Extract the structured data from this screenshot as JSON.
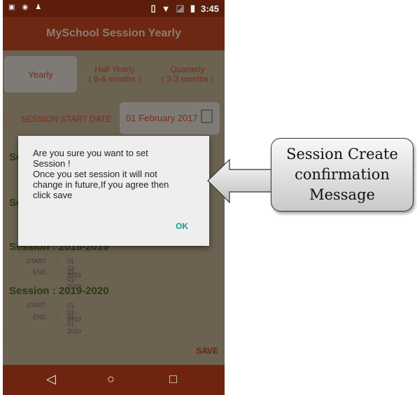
{
  "status_bar": {
    "time": "3:45",
    "icons": [
      "image-icon",
      "news-icon",
      "android-icon",
      "vibrate-icon",
      "wifi-icon",
      "no-sim-icon",
      "battery-charging-icon"
    ]
  },
  "app_bar": {
    "title": "MySchool Session Yearly"
  },
  "tabs": [
    {
      "label": "Yearly",
      "sub": ""
    },
    {
      "label": "Half Yearly",
      "sub": "( 6-6 months )"
    },
    {
      "label": "Quarterly",
      "sub": "( 3-3 months )"
    }
  ],
  "start_date": {
    "label": "SESSION START DATE  :",
    "value": "01 February 2017"
  },
  "sessions_obscured": [
    "Se",
    "Se"
  ],
  "sessions": [
    {
      "title": "Session : 2018-2019",
      "start_label": "START",
      "start": "01-02-2018",
      "end_label": "END",
      "end": "31-01-2019"
    },
    {
      "title": "Session : 2019-2020",
      "start_label": "START",
      "start": "01-02-2019",
      "end_label": "END",
      "end": "31-01-2020"
    }
  ],
  "separator": ":",
  "save_label": "SAVE",
  "dialog": {
    "message": "Are you sure you want to set\nSession !\nOnce you set session it will not\nchange in future,If you agree then\nclick save",
    "ok_label": "OK"
  },
  "callout": {
    "text": "Session Create\nconfirmation\nMessage"
  },
  "colors": {
    "app_bar": "#6d2712",
    "accent": "#1a9b8a",
    "session_title": "#2c3a12"
  }
}
